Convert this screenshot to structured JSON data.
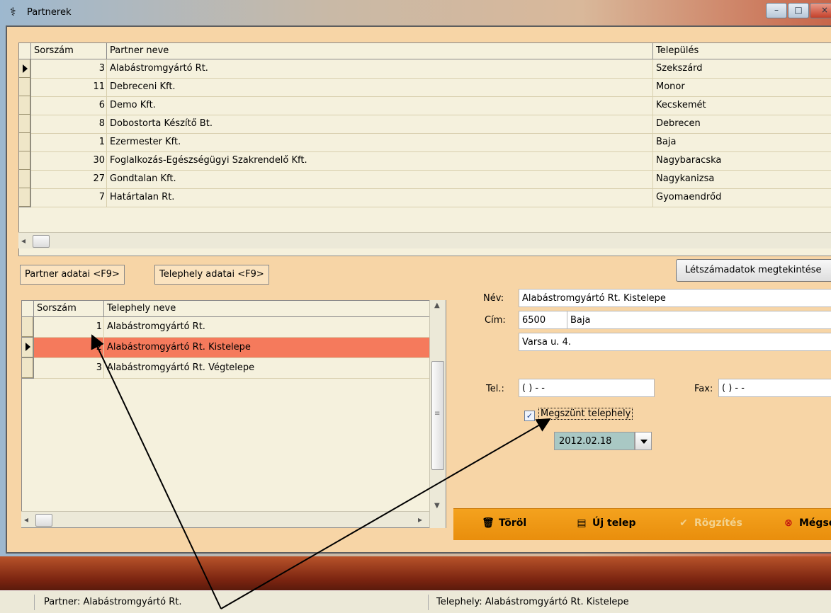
{
  "window": {
    "title": "Partnerek",
    "min_glyph": "–",
    "max_glyph": "□",
    "close_glyph": "×"
  },
  "partners": {
    "columns": [
      "Sorszám",
      "Partner neve",
      "Település"
    ],
    "rows": [
      {
        "num": "3",
        "name": "Alabástromgyártó Rt.",
        "city": "Szekszárd"
      },
      {
        "num": "11",
        "name": "Debreceni Kft.",
        "city": "Monor"
      },
      {
        "num": "6",
        "name": "Demo Kft.",
        "city": "Kecskemét"
      },
      {
        "num": "8",
        "name": "Dobostorta Készítő Bt.",
        "city": "Debrecen"
      },
      {
        "num": "1",
        "name": "Ezermester Kft.",
        "city": "Baja"
      },
      {
        "num": "30",
        "name": "Foglalkozás-Egészségügyi Szakrendelő Kft.",
        "city": "Nagybaracska"
      },
      {
        "num": "27",
        "name": "Gondtalan Kft.",
        "city": "Nagykanizsa"
      },
      {
        "num": "7",
        "name": "Határtalan Rt.",
        "city": "Gyomaendrőd"
      }
    ],
    "selected_index": 0
  },
  "tabs": {
    "partner": "Partner adatai <F9>",
    "telephely": "Telephely adatai <F9>"
  },
  "letszam_button": "Létszámadatok megtekintése",
  "sites": {
    "columns": [
      "Sorszám",
      "Telephely neve"
    ],
    "rows": [
      {
        "num": "1",
        "name": "Alabástromgyártó Rt."
      },
      {
        "num": "2",
        "name": "Alabástromgyártó Rt. Kistelepe"
      },
      {
        "num": "3",
        "name": "Alabástromgyártó Rt. Végtelepe"
      }
    ],
    "selected_index": 1,
    "highlight_color": "#f57a5c"
  },
  "form": {
    "nev_label": "Név:",
    "nev_value": "Alabástromgyártó Rt. Kistelepe",
    "cim_label": "Cím:",
    "irsz": "6500",
    "varos": "Baja",
    "utca": "Varsa u. 4.",
    "tel_label": "Tel.:",
    "tel_value": "( )  -  -",
    "fax_label": "Fax:",
    "fax_value": "( )  -  -",
    "megszunt_label": "Megszünt telephely",
    "megszunt_checked": true,
    "date_value": "2012.02.18"
  },
  "toolbar": {
    "torol": "Töröl",
    "uj_telep": "Új telep",
    "rogzites": "Rögzítés",
    "megse": "Mégse"
  },
  "status": {
    "partner": "Partner: Alabástromgyártó Rt.",
    "telephely": "Telephely: Alabástromgyártó Rt. Kistelepe"
  },
  "colors": {
    "panel": "#f7d5a6",
    "toolbar": "#f09a16",
    "grid_bg": "#f5f1dd"
  }
}
